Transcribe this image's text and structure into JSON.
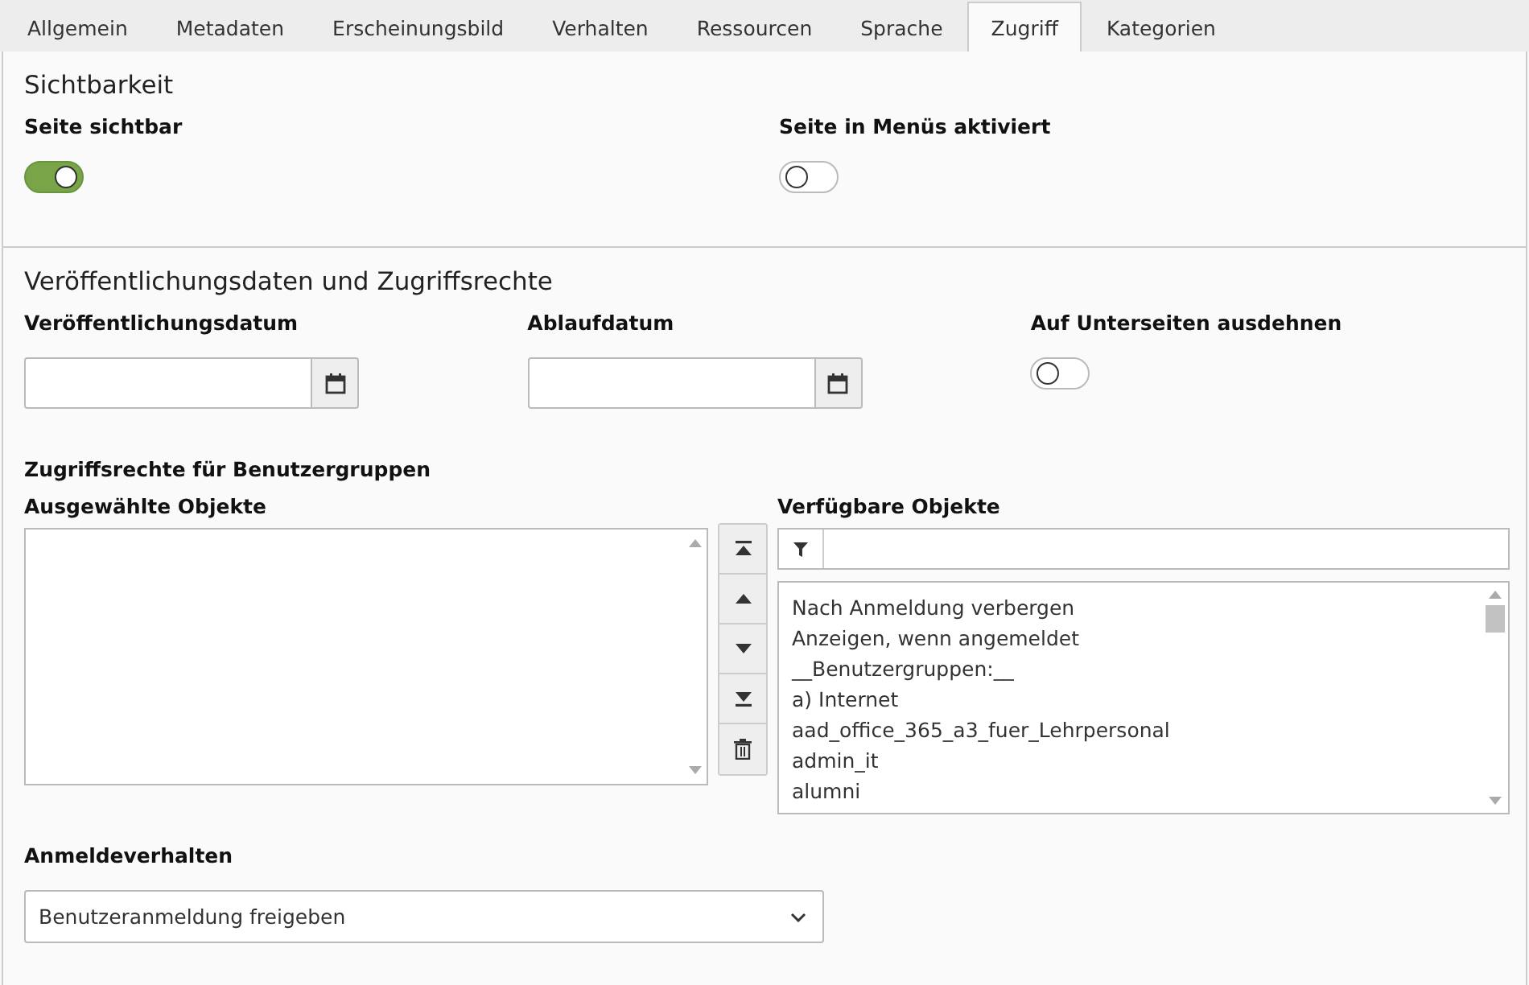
{
  "tabs": [
    {
      "label": "Allgemein",
      "selected": false
    },
    {
      "label": "Metadaten",
      "selected": false
    },
    {
      "label": "Erscheinungsbild",
      "selected": false
    },
    {
      "label": "Verhalten",
      "selected": false
    },
    {
      "label": "Ressourcen",
      "selected": false
    },
    {
      "label": "Sprache",
      "selected": false
    },
    {
      "label": "Zugriff",
      "selected": true
    },
    {
      "label": "Kategorien",
      "selected": false
    }
  ],
  "sections": [
    {
      "title": "Sichtbarkeit",
      "fields": [
        {
          "kind": "toggle",
          "label": "Seite sichtbar",
          "on": true
        },
        {
          "kind": "toggle",
          "label": "Seite in Menüs aktiviert",
          "on": false
        }
      ]
    },
    {
      "title": "Veröffentlichungsdaten und Zugriffsrechte",
      "fields": [
        {
          "kind": "date",
          "label": "Veröffentlichungsdatum"
        },
        {
          "kind": "date",
          "label": "Ablaufdatum"
        },
        {
          "kind": "toggle",
          "label": "Auf Unterseiten ausdehnen",
          "on": false
        }
      ]
    }
  ],
  "group_access": {
    "title": "Zugriffsrechte für Benutzergruppen",
    "selected_label": "Ausgewählte Objekte",
    "available_label": "Verfügbare Objekte",
    "available_items": [
      "Nach Anmeldung verbergen",
      "Anzeigen, wenn angemeldet",
      "__Benutzergruppen:__",
      "a) Internet",
      "aad_office_365_a3_fuer_Lehrpersonal",
      "admin_it",
      "alumni"
    ]
  },
  "login": {
    "label": "Anmeldeverhalten",
    "value": "Benutzeranmeldung freigeben"
  }
}
